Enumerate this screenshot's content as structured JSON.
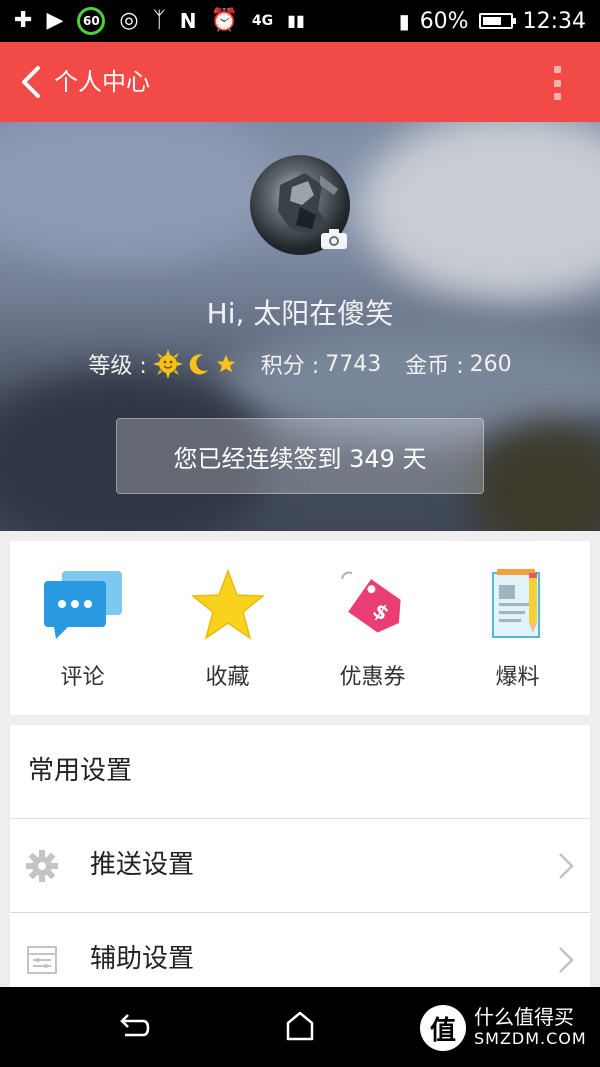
{
  "status_bar": {
    "badge": "60",
    "network": "4G",
    "battery": "60%",
    "time": "12:34"
  },
  "app_bar": {
    "title": "个人中心",
    "background": "#f24a46"
  },
  "profile": {
    "greeting": "Hi, 太阳在傻笑",
    "level_label": "等级 :",
    "points_label": "积分 :",
    "points": "7743",
    "coins_label": "金币 :",
    "coins": "260",
    "signin_text": "您已经连续签到 349 天"
  },
  "quick_actions": [
    {
      "label": "评论",
      "icon": "comment-icon"
    },
    {
      "label": "收藏",
      "icon": "star-icon"
    },
    {
      "label": "优惠券",
      "icon": "coupon-icon"
    },
    {
      "label": "爆料",
      "icon": "report-icon"
    }
  ],
  "settings": {
    "header": "常用设置",
    "items": [
      {
        "label": "推送设置",
        "icon": "gear-icon"
      },
      {
        "label": "辅助设置",
        "icon": "sliders-icon"
      }
    ]
  },
  "watermark": {
    "badge": "值",
    "line1": "什么值得买",
    "line2": "SMZDM.COM"
  }
}
